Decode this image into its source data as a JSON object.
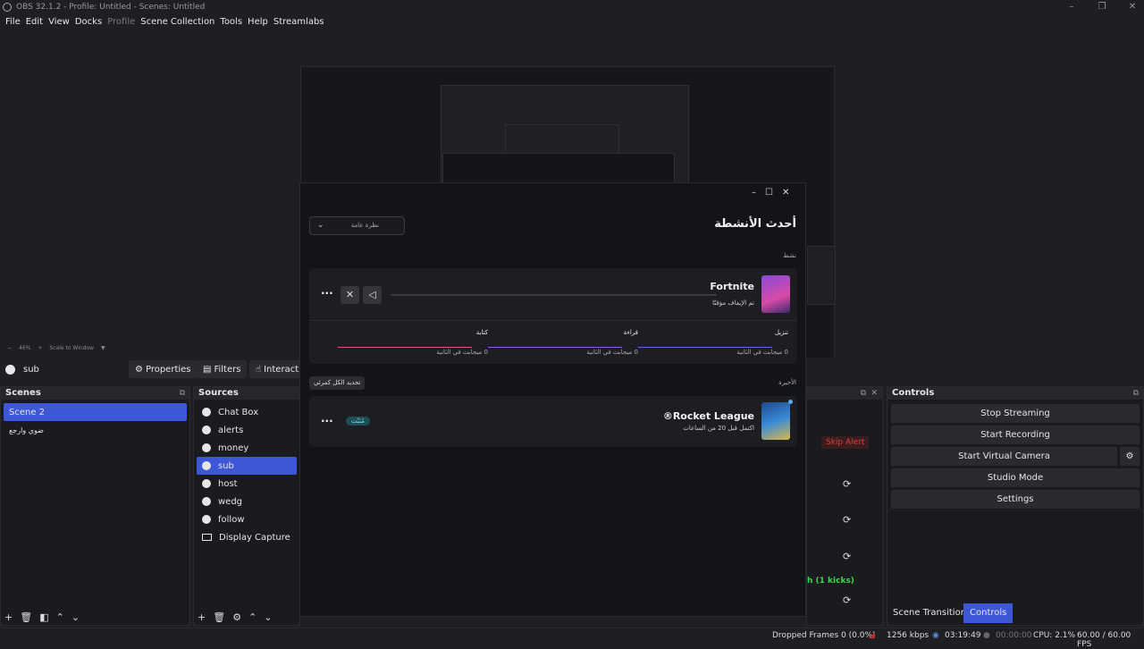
{
  "window": {
    "title": "OBS 32.1.2 - Profile: Untitled - Scenes: Untitled"
  },
  "menu": [
    {
      "label": "File",
      "dim": false
    },
    {
      "label": "Edit",
      "dim": false
    },
    {
      "label": "View",
      "dim": false
    },
    {
      "label": "Docks",
      "dim": false
    },
    {
      "label": "Profile",
      "dim": true
    },
    {
      "label": "Scene Collection",
      "dim": false
    },
    {
      "label": "Tools",
      "dim": false
    },
    {
      "label": "Help",
      "dim": false
    },
    {
      "label": "Streamlabs",
      "dim": false
    }
  ],
  "preview": {
    "zoom_minus": "−",
    "zoom_pct": "46%",
    "zoom_plus": "+",
    "scale_label": "Scale to Window"
  },
  "source_bar": {
    "current_source": "sub",
    "properties_label": "Properties",
    "filters_label": "Filters",
    "interact_label": "Interact"
  },
  "scenes": {
    "title": "Scenes",
    "items": [
      "Scene 2",
      "ضوي وارجع"
    ]
  },
  "sources": {
    "title": "Sources",
    "items": [
      {
        "label": "Chat Box",
        "icon": "globe-icon"
      },
      {
        "label": "alerts",
        "icon": "globe-icon"
      },
      {
        "label": "money",
        "icon": "globe-icon"
      },
      {
        "label": "sub",
        "icon": "globe-icon"
      },
      {
        "label": "host",
        "icon": "globe-icon"
      },
      {
        "label": "wedg",
        "icon": "globe-icon"
      },
      {
        "label": "follow",
        "icon": "globe-icon"
      },
      {
        "label": "Display Capture",
        "icon": "monitor-icon"
      }
    ]
  },
  "alert_dock": {
    "skip_label": "Skip Alert",
    "kicks_text": "h (1 kicks)"
  },
  "controls": {
    "title": "Controls",
    "buttons": [
      "Stop Streaming",
      "Start Recording",
      "Start Virtual Camera",
      "Studio Mode",
      "Settings"
    ],
    "tab_transitions": "Scene Transitions",
    "tab_controls": "Controls"
  },
  "status": {
    "dropped": "Dropped Frames 0 (0.0%)",
    "bitrate": "1256 kbps",
    "stream_time": "03:19:49",
    "rec_time": "00:00:00",
    "cpu": "CPU: 2.1%",
    "fps": "60.00 / 60.00 FPS"
  },
  "activity": {
    "title": "أحدث الأنشطة",
    "filter_value": "نظرة عامة",
    "section_active": "نشط",
    "game1_name": "Fortnite",
    "game1_status": "تم الإيقاف مؤقتًا",
    "stats": [
      {
        "label": "تنزيل",
        "value": "0 ميجابت في الثانية",
        "color": "#5a6ad8"
      },
      {
        "label": "قراءة",
        "value": "0 ميجابت في الثانية",
        "color": "#9a5ad8"
      },
      {
        "label": "كتابة",
        "value": "0 ميجابت في الثانية",
        "color": "#d85a7a"
      }
    ],
    "section_recent": "الأخيرة",
    "update_all_label": "تحديد الكل كمرئي",
    "game2_name": "Rocket League®",
    "game2_status": "اكتمل قبل 20 من الساعات",
    "game2_pill": "مُثبّت"
  },
  "colors": {
    "accent": "#3d57d6",
    "skip_red": "#e0403a",
    "kicks_green": "#3ad84a"
  }
}
